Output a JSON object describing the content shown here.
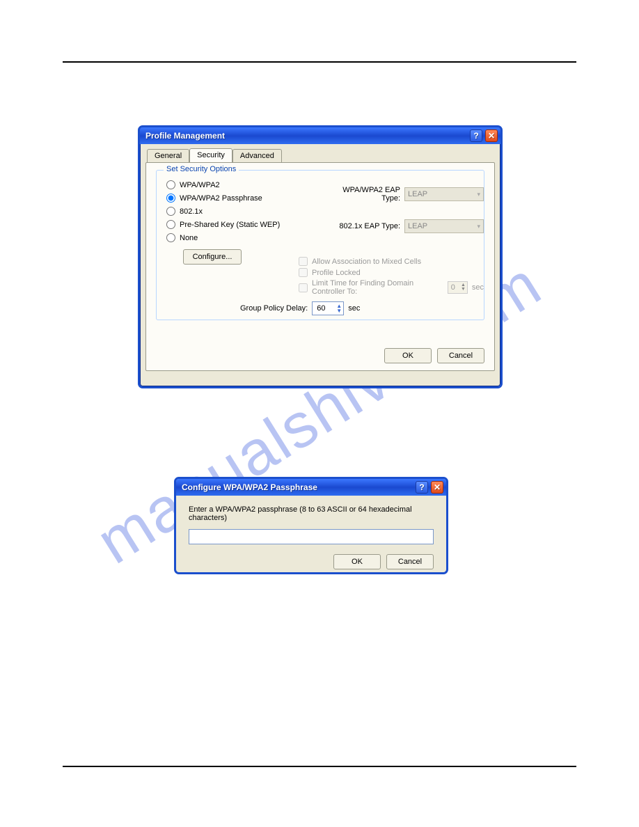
{
  "dialog1": {
    "title": "Profile Management",
    "tabs": {
      "general": "General",
      "security": "Security",
      "advanced": "Advanced"
    },
    "groupbox_legend": "Set Security Options",
    "radios": {
      "wpa": "WPA/WPA2",
      "wpa_pass": "WPA/WPA2 Passphrase",
      "dot1x": "802.1x",
      "psk": "Pre-Shared Key (Static WEP)",
      "none": "None"
    },
    "eap": {
      "wpa_label": "WPA/WPA2 EAP Type:",
      "wpa_value": "LEAP",
      "dot1x_label": "802.1x EAP Type:",
      "dot1x_value": "LEAP"
    },
    "configure_btn": "Configure...",
    "checks": {
      "allow_mixed": "Allow Association to Mixed Cells",
      "profile_locked": "Profile Locked",
      "limit_time": "Limit Time for Finding Domain Controller To:",
      "limit_value": "0",
      "limit_unit": "sec"
    },
    "gpd_label": "Group Policy Delay:",
    "gpd_value": "60",
    "gpd_unit": "sec",
    "ok": "OK",
    "cancel": "Cancel"
  },
  "dialog2": {
    "title": "Configure WPA/WPA2 Passphrase",
    "instruction": "Enter a WPA/WPA2 passphrase (8 to 63 ASCII or 64 hexadecimal characters)",
    "ok": "OK",
    "cancel": "Cancel"
  },
  "watermark": "manualshive.com"
}
